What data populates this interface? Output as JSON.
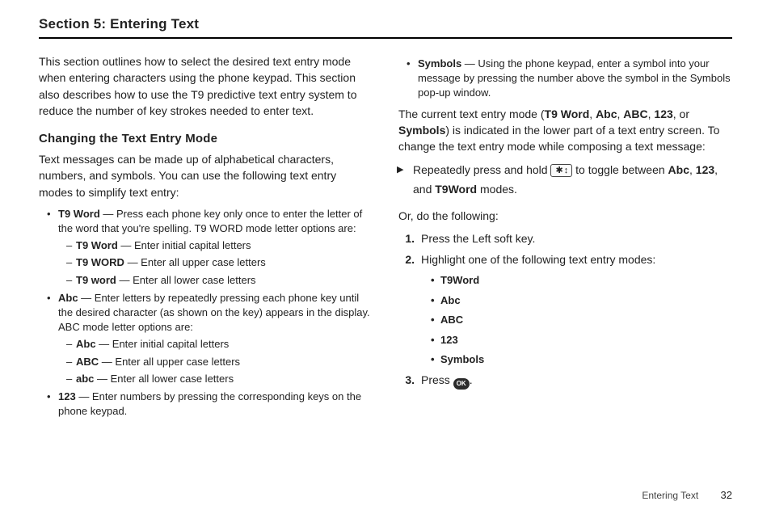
{
  "section_title": "Section 5: Entering Text",
  "left": {
    "intro": "This section outlines how to select the desired text entry mode when entering characters using the phone keypad. This section also describes how to use the T9 predictive text entry system to reduce the number of key strokes needed to enter text.",
    "subhead": "Changing the Text Entry Mode",
    "para": "Text messages can be made up of alphabetical characters, numbers, and symbols. You can use the following text entry modes to simplify text entry:",
    "t9_lead_b": "T9 Word",
    "t9_lead_rest": " — Press each phone key only once to enter the letter of the word that you're spelling. T9 WORD mode letter options are:",
    "t9_a_b": "T9 Word",
    "t9_a_r": " — Enter initial capital letters",
    "t9_b_b": "T9 WORD",
    "t9_b_r": " — Enter all upper case letters",
    "t9_c_b": "T9 word",
    "t9_c_r": " — Enter all lower case letters",
    "abc_lead_b": "Abc",
    "abc_lead_rest": " — Enter letters by repeatedly pressing each phone key until the desired character (as shown on the key) appears in the display. ABC mode letter options are:",
    "abc_a_b": "Abc",
    "abc_a_r": " — Enter initial capital letters",
    "abc_b_b": "ABC",
    "abc_b_r": " — Enter all upper case letters",
    "abc_c_b": "abc",
    "abc_c_r": " — Enter all lower case letters",
    "num_lead_b": "123",
    "num_lead_rest": " — Enter numbers by pressing the corresponding keys on the phone keypad."
  },
  "right": {
    "sym_lead_b": "Symbols",
    "sym_lead_rest": " — Using the phone keypad, enter a symbol into your message by pressing the number above the symbol in the Symbols pop-up window.",
    "current_p1": "The current text entry mode (",
    "m1": "T9 Word",
    "c1": ", ",
    "m2": "Abc",
    "c2": ", ",
    "m3": "ABC",
    "c3": ", ",
    "m4": "123",
    "c4": ", or ",
    "m5": "Symbols",
    "current_p2": ") is indicated in the lower part of a text entry screen. To change the text entry mode while composing a text message:",
    "arrow_p1": "Repeatedly press and hold ",
    "key_glyph": "✱ ↕",
    "arrow_p2": " to toggle between ",
    "ab1": "Abc",
    "ac1": ", ",
    "ab2": "123",
    "ac2": ", and ",
    "ab3": "T9Word",
    "arrow_p3": " modes.",
    "or_line": "Or, do the following:",
    "step1_n": "1.",
    "step1_t": "Press the Left soft key.",
    "step2_n": "2.",
    "step2_t": "Highlight one of the following text entry modes:",
    "opt1": "T9Word",
    "opt2": "Abc",
    "opt3": "ABC",
    "opt4": "123",
    "opt5": "Symbols",
    "step3_n": "3.",
    "step3_t1": "Press ",
    "ok_label": "OK",
    "step3_t2": "."
  },
  "footer": {
    "label": "Entering Text",
    "page": "32"
  }
}
